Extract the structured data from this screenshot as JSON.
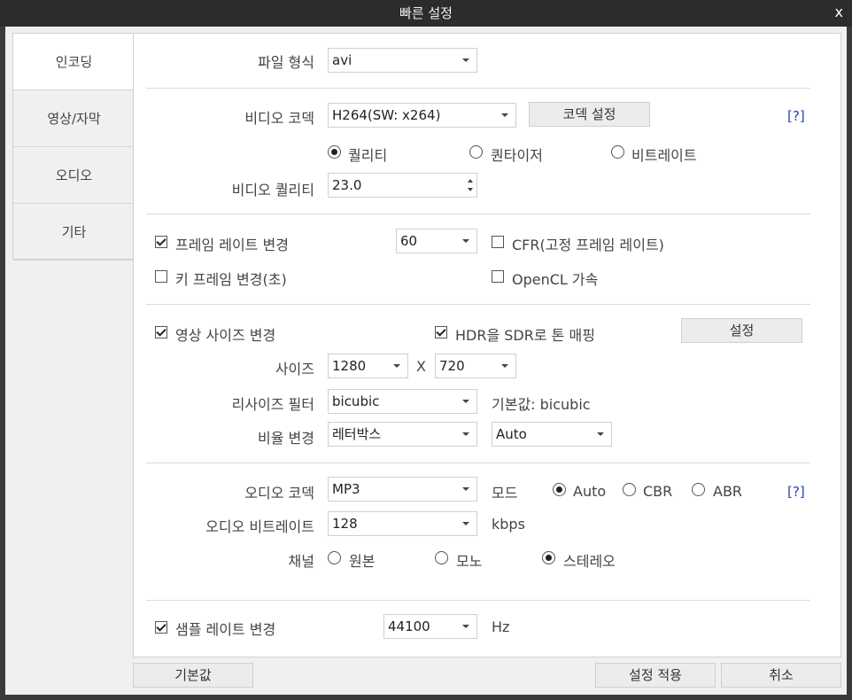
{
  "window": {
    "title": "빠른 설정",
    "close": "x"
  },
  "sidebar": {
    "items": [
      {
        "label": "인코딩"
      },
      {
        "label": "영상/자막"
      },
      {
        "label": "오디오"
      },
      {
        "label": "기타"
      }
    ]
  },
  "format": {
    "label": "파일 형식",
    "value": "avi"
  },
  "video": {
    "codec_label": "비디오 코덱",
    "codec_value": "H264(SW: x264)",
    "codec_settings_button": "코덱 설정",
    "help": "[?]",
    "mode_options": [
      "퀄리티",
      "퀀타이저",
      "비트레이트"
    ],
    "mode_selected": "퀄리티",
    "quality_label": "비디오 퀄리티",
    "quality_value": "23.0"
  },
  "frame": {
    "change_fps_label": "프레임 레이트 변경",
    "change_fps_checked": true,
    "fps_value": "60",
    "cfr_label": "CFR(고정 프레임 레이트)",
    "cfr_checked": false,
    "keyframe_label": "키 프레임 변경(초)",
    "keyframe_checked": false,
    "opencl_label": "OpenCL 가속",
    "opencl_checked": false
  },
  "size": {
    "change_size_label": "영상 사이즈 변경",
    "change_size_checked": true,
    "hdr_label": "HDR을 SDR로 톤 매핑",
    "hdr_checked": true,
    "settings_button": "설정",
    "size_label": "사이즈",
    "width": "1280",
    "x": "X",
    "height": "720",
    "filter_label": "리사이즈 필터",
    "filter_value": "bicubic",
    "filter_default": "기본값: bicubic",
    "ratio_label": "비율 변경",
    "ratio_value": "레터박스",
    "ratio_value2": "Auto"
  },
  "audio": {
    "codec_label": "오디오 코덱",
    "codec_value": "MP3",
    "mode_label": "모드",
    "mode_options": [
      "Auto",
      "CBR",
      "ABR"
    ],
    "mode_selected": "Auto",
    "help": "[?]",
    "bitrate_label": "오디오 비트레이트",
    "bitrate_value": "128",
    "bitrate_unit": "kbps",
    "channel_label": "채널",
    "channel_options": [
      "원본",
      "모노",
      "스테레오"
    ],
    "channel_selected": "스테레오",
    "sample_label": "샘플 레이트 변경",
    "sample_checked": true,
    "sample_value": "44100",
    "sample_unit": "Hz"
  },
  "footer": {
    "default_button": "기본값",
    "apply_button": "설정 적용",
    "cancel_button": "취소"
  }
}
